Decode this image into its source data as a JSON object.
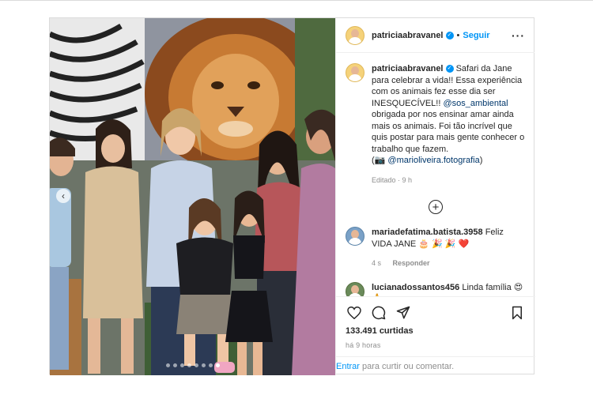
{
  "colors": {
    "accent": "#0095f6",
    "verified": "#0095f6",
    "text": "#262626",
    "muted": "#8e8e8e"
  },
  "post": {
    "username": "patriciaabravanel",
    "follow_label": "Seguir",
    "separator": "•",
    "more_icon": "more-horizontal-icon",
    "carousel": {
      "total_slides": 8,
      "active_slide": 8
    }
  },
  "caption": {
    "username": "patriciaabravanel",
    "text_1": "Safari da Jane para celebrar a vida!! Essa experiência com os animais fez esse dia ser INESQUECÍVEL!! ",
    "mention_1": "@sos_ambiental",
    "text_2": " obrigada por nos ensinar amar ainda mais os animais. Foi tão incrível que quis postar para mais gente conhecer o trabalho que fazem.",
    "text_3": "(📷 ",
    "mention_2": "@marioliveira.fotografia",
    "text_4": ")",
    "meta": "Editado · 9 h"
  },
  "comments": [
    {
      "username": "mariadefatima.batista.3958",
      "text": "Feliz VIDA JANE 🎂 🎉 🎉 ❤️",
      "time": "4 s",
      "reply": "Responder"
    },
    {
      "username": "lucianadossantos456",
      "text": "Linda família 😍 🙏",
      "time": "",
      "reply": ""
    }
  ],
  "stats": {
    "likes": "133.491 curtidas",
    "ago": "HÁ 9 HORAS",
    "ago_display": "há 9 horas"
  },
  "footer": {
    "login_label": "Entrar",
    "prompt": "para curtir ou comentar."
  }
}
